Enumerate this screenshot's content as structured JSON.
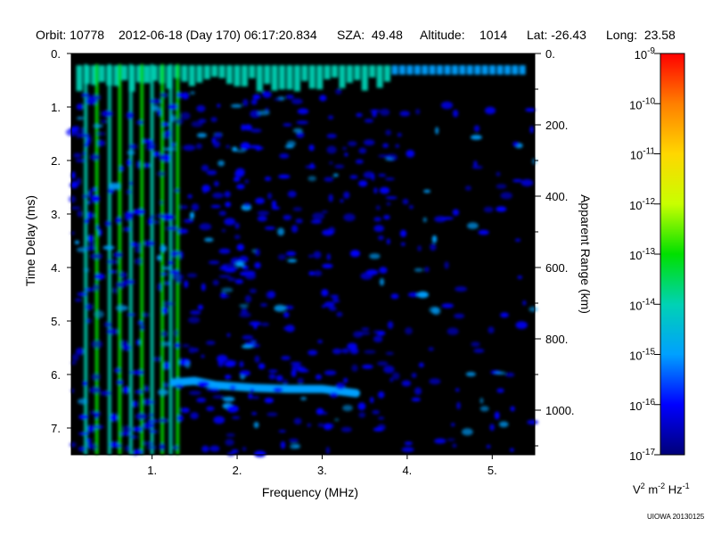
{
  "header": {
    "orbit": "Orbit: 10778",
    "datetime": "2012-06-18 (Day 170) 06:17:20.834",
    "sza": "SZA:  49.48",
    "altitude_label": "Altitude:",
    "altitude_value": "1014",
    "lat": "Lat: -26.43",
    "long": "Long:  23.58"
  },
  "colorbar": {
    "units_base_v": "V",
    "units_exp_v": "2",
    "units_base_m": "m",
    "units_exp_m": "-2",
    "units_base_hz": "Hz",
    "units_exp_hz": "-1",
    "tick_labels": [
      {
        "base": "10",
        "exp": "-9"
      },
      {
        "base": "10",
        "exp": "-10"
      },
      {
        "base": "10",
        "exp": "-11"
      },
      {
        "base": "10",
        "exp": "-12"
      },
      {
        "base": "10",
        "exp": "-13"
      },
      {
        "base": "10",
        "exp": "-14"
      },
      {
        "base": "10",
        "exp": "-15"
      },
      {
        "base": "10",
        "exp": "-16"
      },
      {
        "base": "10",
        "exp": "-17"
      }
    ],
    "colors": [
      "#ff0000",
      "#ff7f00",
      "#ffd700",
      "#c8ff00",
      "#00e000",
      "#00d2b4",
      "#00a0ff",
      "#0000ff",
      "#000078"
    ]
  },
  "credit": "UIOWA 20130125",
  "chart_data": {
    "type": "heatmap",
    "xlabel": "Frequency (MHz)",
    "ylabel": "Time Delay (ms)",
    "y2label": "Apparent Range (km)",
    "x_ticks": [
      "1.",
      "2.",
      "3.",
      "4.",
      "5."
    ],
    "x_tick_values": [
      1,
      2,
      3,
      4,
      5
    ],
    "xlim": [
      0.05,
      5.5
    ],
    "y_ticks": [
      "0.",
      "1.",
      "2.",
      "3.",
      "4.",
      "5.",
      "6.",
      "7."
    ],
    "y_tick_values": [
      0,
      1,
      2,
      3,
      4,
      5,
      6,
      7
    ],
    "ylim": [
      0,
      7.5
    ],
    "y2_ticks": [
      "0.",
      "200.",
      "400.",
      "600.",
      "800.",
      "1000."
    ],
    "y2_tick_values": [
      0,
      200,
      400,
      600,
      800,
      1000
    ],
    "y2lim": [
      0,
      1125
    ],
    "color_scale": "log",
    "zlim": [
      1e-17,
      1e-09
    ],
    "background_level": 1e-17,
    "features": [
      {
        "kind": "surface_echo_band",
        "delay_range": [
          0.22,
          0.72
        ],
        "freq_range": [
          0.1,
          5.4
        ],
        "level": 1e-14
      },
      {
        "kind": "vertical_lines",
        "freqs": [
          0.22,
          0.35,
          0.5,
          0.62,
          0.75,
          0.88,
          1.0,
          1.12,
          1.22,
          1.3
        ],
        "delay_range": [
          0.2,
          7.5
        ],
        "level": 1e-14
      },
      {
        "kind": "ionospheric_trace",
        "points": [
          [
            1.25,
            6.15
          ],
          [
            1.5,
            6.12
          ],
          [
            1.75,
            6.2
          ],
          [
            2.2,
            6.25
          ],
          [
            2.6,
            6.27
          ],
          [
            3.0,
            6.27
          ],
          [
            3.4,
            6.35
          ]
        ],
        "level": 1e-15
      },
      {
        "kind": "noise",
        "freq_range": [
          0.05,
          5.5
        ],
        "delay_range": [
          0.7,
          7.5
        ],
        "level": 1e-16
      }
    ]
  }
}
